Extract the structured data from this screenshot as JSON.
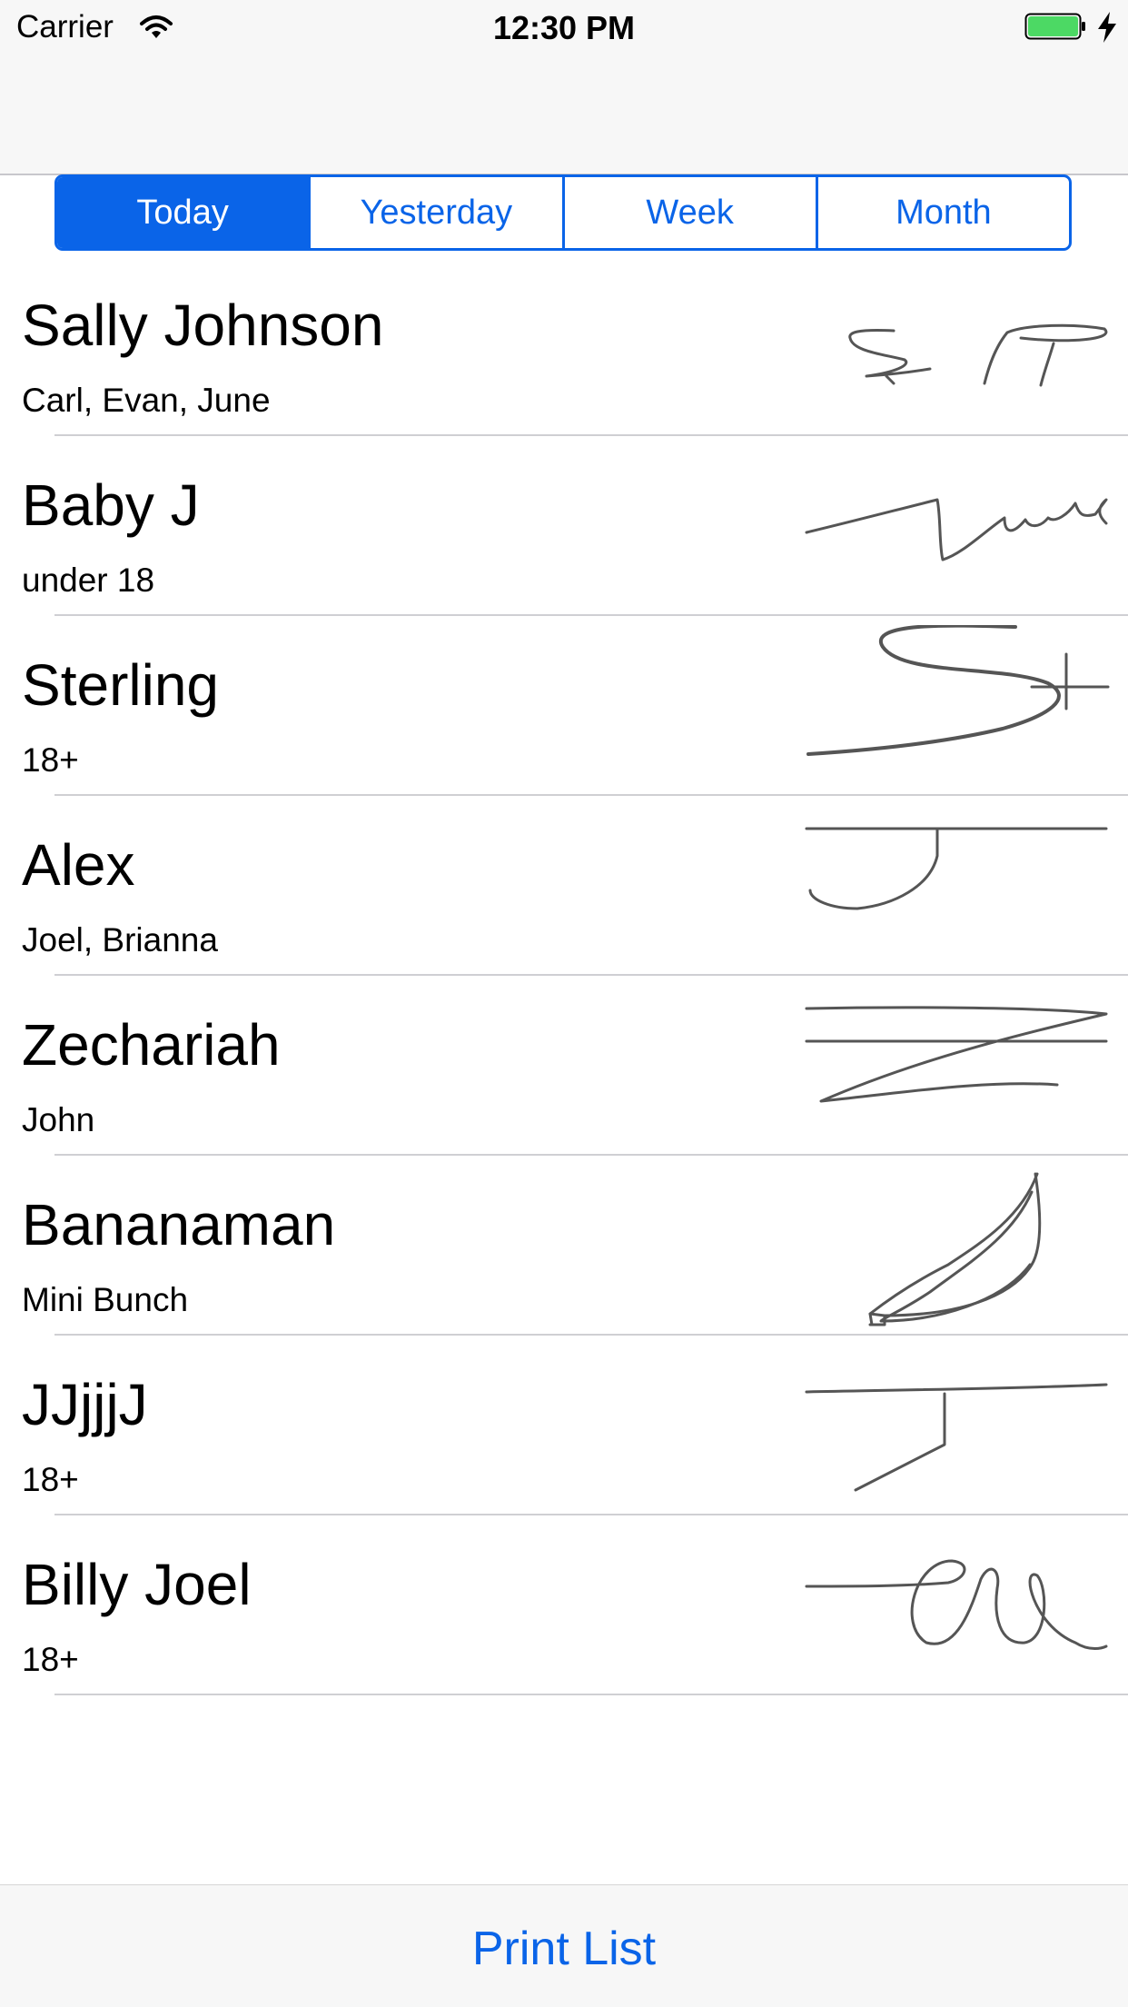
{
  "status_bar": {
    "carrier": "Carrier",
    "time": "12:30 PM",
    "battery_color": "#4cd964"
  },
  "segments": [
    {
      "label": "Today",
      "selected": true
    },
    {
      "label": "Yesterday",
      "selected": false
    },
    {
      "label": "Week",
      "selected": false
    },
    {
      "label": "Month",
      "selected": false
    }
  ],
  "entries": [
    {
      "name": "Sally Johnson",
      "detail": "Carl, Evan, June",
      "signature": "signature-image"
    },
    {
      "name": "Baby J",
      "detail": "under 18",
      "signature": "signature-image"
    },
    {
      "name": "Sterling",
      "detail": "18+",
      "signature": "signature-image"
    },
    {
      "name": "Alex",
      "detail": "Joel, Brianna",
      "signature": "signature-image"
    },
    {
      "name": "Zechariah",
      "detail": "John",
      "signature": "signature-image"
    },
    {
      "name": "Bananaman",
      "detail": "Mini Bunch",
      "signature": "signature-image"
    },
    {
      "name": "JJjjjJ",
      "detail": "18+",
      "signature": "signature-image"
    },
    {
      "name": "Billy Joel",
      "detail": "18+",
      "signature": "signature-image"
    }
  ],
  "toolbar": {
    "print_label": "Print List"
  },
  "colors": {
    "accent": "#0a64e8",
    "bar_background": "#f7f7f7",
    "separator": "#cfcfd3"
  }
}
